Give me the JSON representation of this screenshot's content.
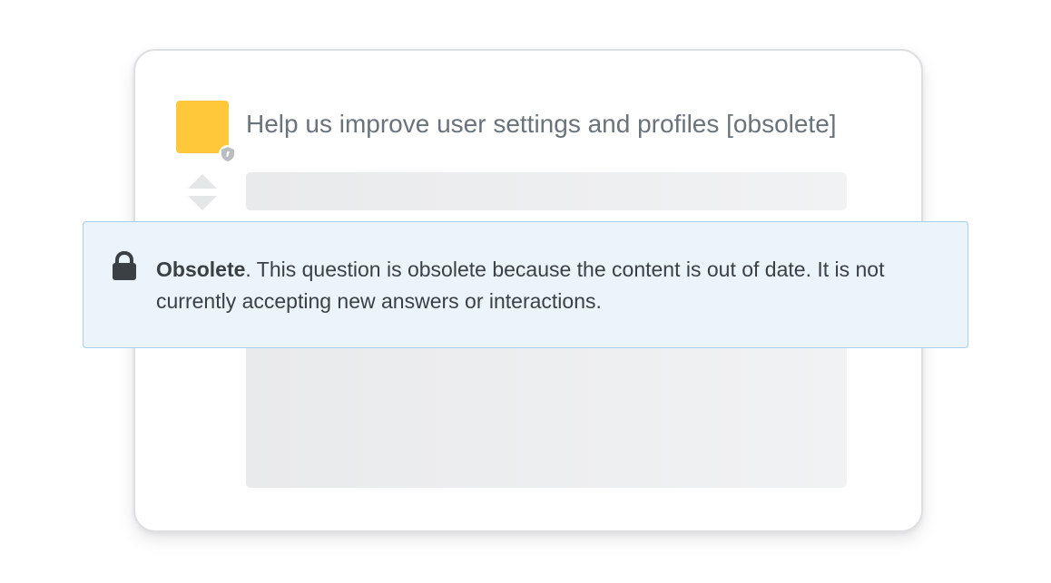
{
  "question": {
    "title": "Help us improve user settings and profiles [obsolete]"
  },
  "notice": {
    "label": "Obsolete",
    "message": ". This question is obsolete because the content is out of date. It is not currently accepting new answers or interactions."
  },
  "colors": {
    "avatar": "#ffc83a",
    "notice_bg": "#ebf4fb",
    "notice_border": "#a6ceed",
    "title_text": "#6a737c",
    "body_text": "#3b4045"
  },
  "icons": {
    "lock": "lock-icon",
    "vote_up": "vote-up-icon",
    "vote_down": "vote-down-icon",
    "badge": "moderator-shield-icon"
  }
}
